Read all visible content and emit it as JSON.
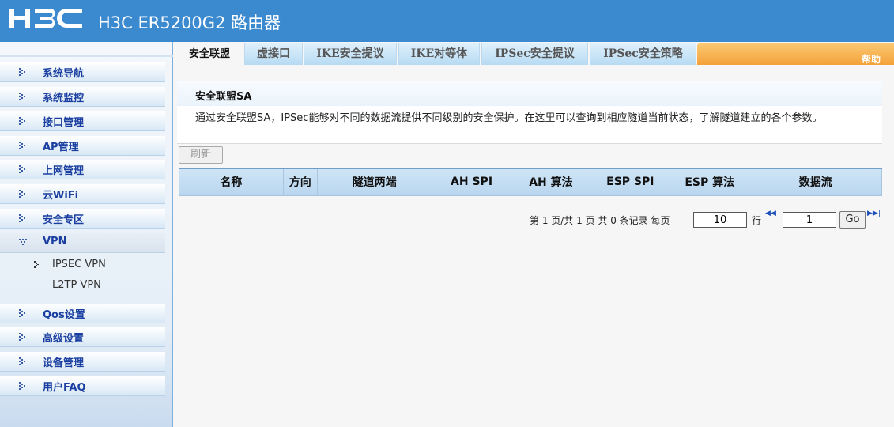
{
  "header": {
    "logo_text": "H3C",
    "title": "H3C ER5200G2 路由器"
  },
  "sidebar": {
    "items": [
      {
        "label": "系统导航"
      },
      {
        "label": "系统监控"
      },
      {
        "label": "接口管理"
      },
      {
        "label": "AP管理"
      },
      {
        "label": "上网管理"
      },
      {
        "label": "云WiFi"
      },
      {
        "label": "安全专区"
      },
      {
        "label": "VPN",
        "expanded": true
      },
      {
        "label": "Qos设置"
      },
      {
        "label": "高级设置"
      },
      {
        "label": "设备管理"
      },
      {
        "label": "用户FAQ"
      }
    ],
    "vpn_sub": [
      {
        "label": "IPSEC VPN",
        "selected": true
      },
      {
        "label": "L2TP VPN"
      }
    ]
  },
  "tabs": [
    {
      "label": "安全联盟",
      "active": true
    },
    {
      "label": "虚接口"
    },
    {
      "label": "IKE安全提议"
    },
    {
      "label": "IKE对等体"
    },
    {
      "label": "IPSec安全提议"
    },
    {
      "label": "IPSec安全策略"
    }
  ],
  "help_label": "帮助",
  "section": {
    "title": "安全联盟SA",
    "description": "通过安全联盟SA，IPSec能够对不同的数据流提供不同级别的安全保护。在这里可以查询到相应隧道当前状态，了解隧道建立的各个参数。"
  },
  "refresh_label": "刷新",
  "table": {
    "columns": [
      "名称",
      "方向",
      "隧道两端",
      "AH SPI",
      "AH 算法",
      "ESP SPI",
      "ESP 算法",
      "数据流"
    ],
    "rows": []
  },
  "pager": {
    "summary": "第 1 页/共 1 页 共 0 条记录 每页",
    "per_page": "10",
    "rows_unit": "行",
    "page": "1",
    "go_label": "Go"
  },
  "colors": {
    "header_bg": "#3b8ad0",
    "nav_text": "#1a3fa0",
    "help_bar": "#f4a23a"
  }
}
